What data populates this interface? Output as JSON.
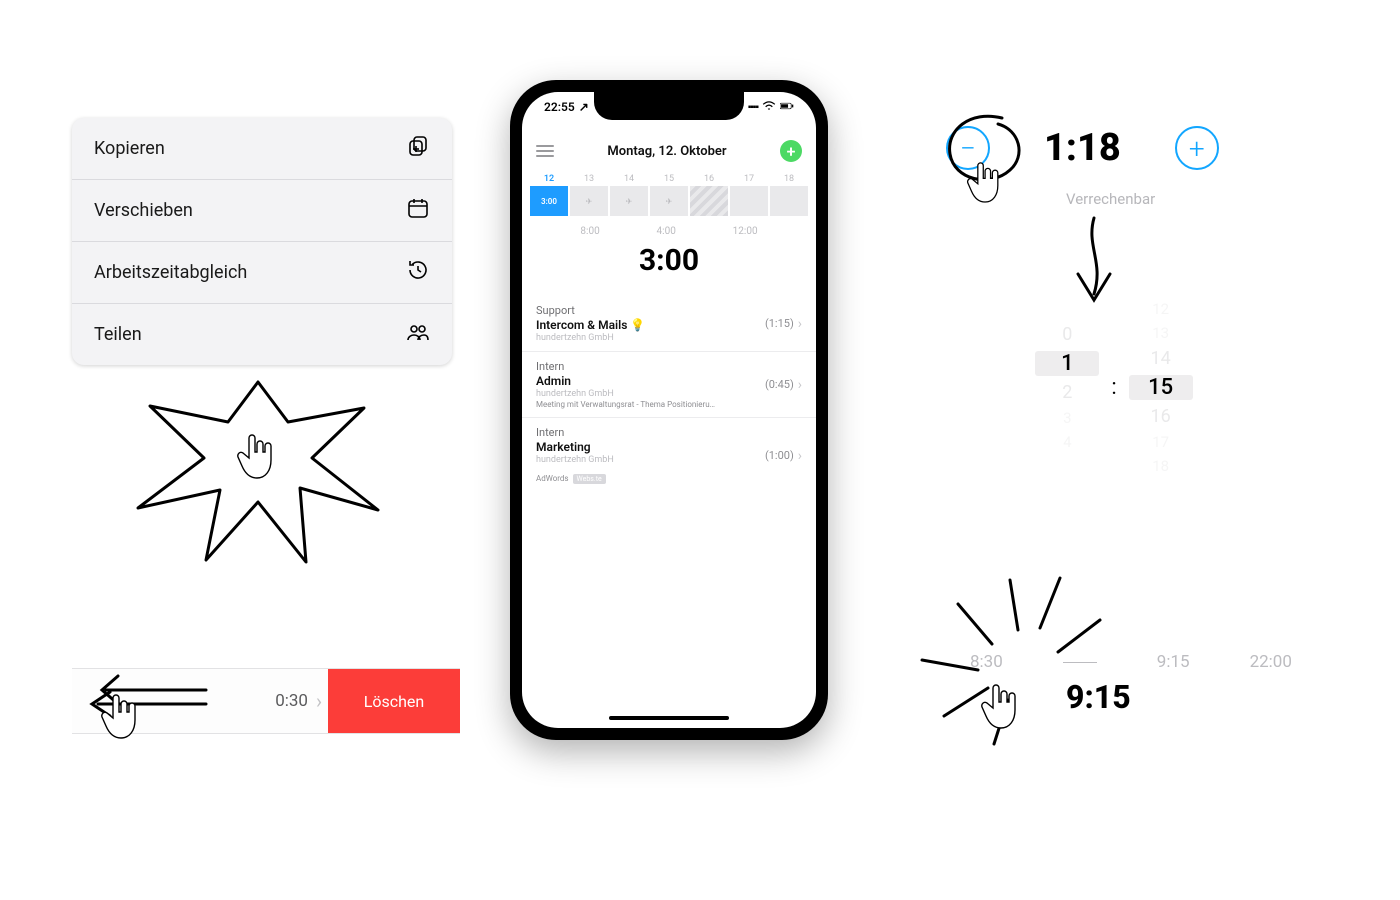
{
  "context_menu": {
    "items": [
      {
        "label": "Kopieren",
        "icon": "copy-plus-icon"
      },
      {
        "label": "Verschieben",
        "icon": "calendar-icon"
      },
      {
        "label": "Arbeitszeitabgleich",
        "icon": "history-icon"
      },
      {
        "label": "Teilen",
        "icon": "people-icon"
      }
    ]
  },
  "swipe_row": {
    "duration": "0:30",
    "delete_label": "Löschen"
  },
  "phone": {
    "status_time": "22:55",
    "header_title": "Montag, 12. Oktober",
    "week_days": [
      {
        "num": "12",
        "cell": "3:00",
        "current": true
      },
      {
        "num": "13",
        "cell": "✈"
      },
      {
        "num": "14",
        "cell": "✈"
      },
      {
        "num": "15",
        "cell": "✈"
      },
      {
        "num": "16",
        "cell": "",
        "stripe": true
      },
      {
        "num": "17",
        "cell": ""
      },
      {
        "num": "18",
        "cell": ""
      }
    ],
    "stats": {
      "c1": "8:00",
      "c2": "4:00",
      "c3": "12:00"
    },
    "total": "3:00",
    "entries": [
      {
        "project": "Support",
        "task": "Intercom & Mails 💡",
        "org": "hundertzehn GmbH",
        "duration": "(1:15)"
      },
      {
        "project": "Intern",
        "task": "Admin",
        "org": "hundertzehn GmbH",
        "note": "Meeting mit Verwaltungsrat - Thema Positionierung…",
        "duration": "(0:45)"
      },
      {
        "project": "Intern",
        "task": "Marketing",
        "org": "hundertzehn GmbH",
        "tags_prefix": "AdWords",
        "tag": "Webs.te",
        "duration": "(1:00)"
      }
    ]
  },
  "stepper": {
    "value": "1:18",
    "billable_label": "Verrechenbar"
  },
  "wheel": {
    "hours": [
      "0",
      "1",
      "2",
      "3",
      "4"
    ],
    "hours_sel_index": 1,
    "minutes": [
      "12",
      "13",
      "14",
      "15",
      "16",
      "17",
      "18"
    ],
    "minutes_sel_index": 3
  },
  "time_range": {
    "start": "8:30",
    "mid": "9:15",
    "end_big": "9:15",
    "stop": "22:00"
  }
}
